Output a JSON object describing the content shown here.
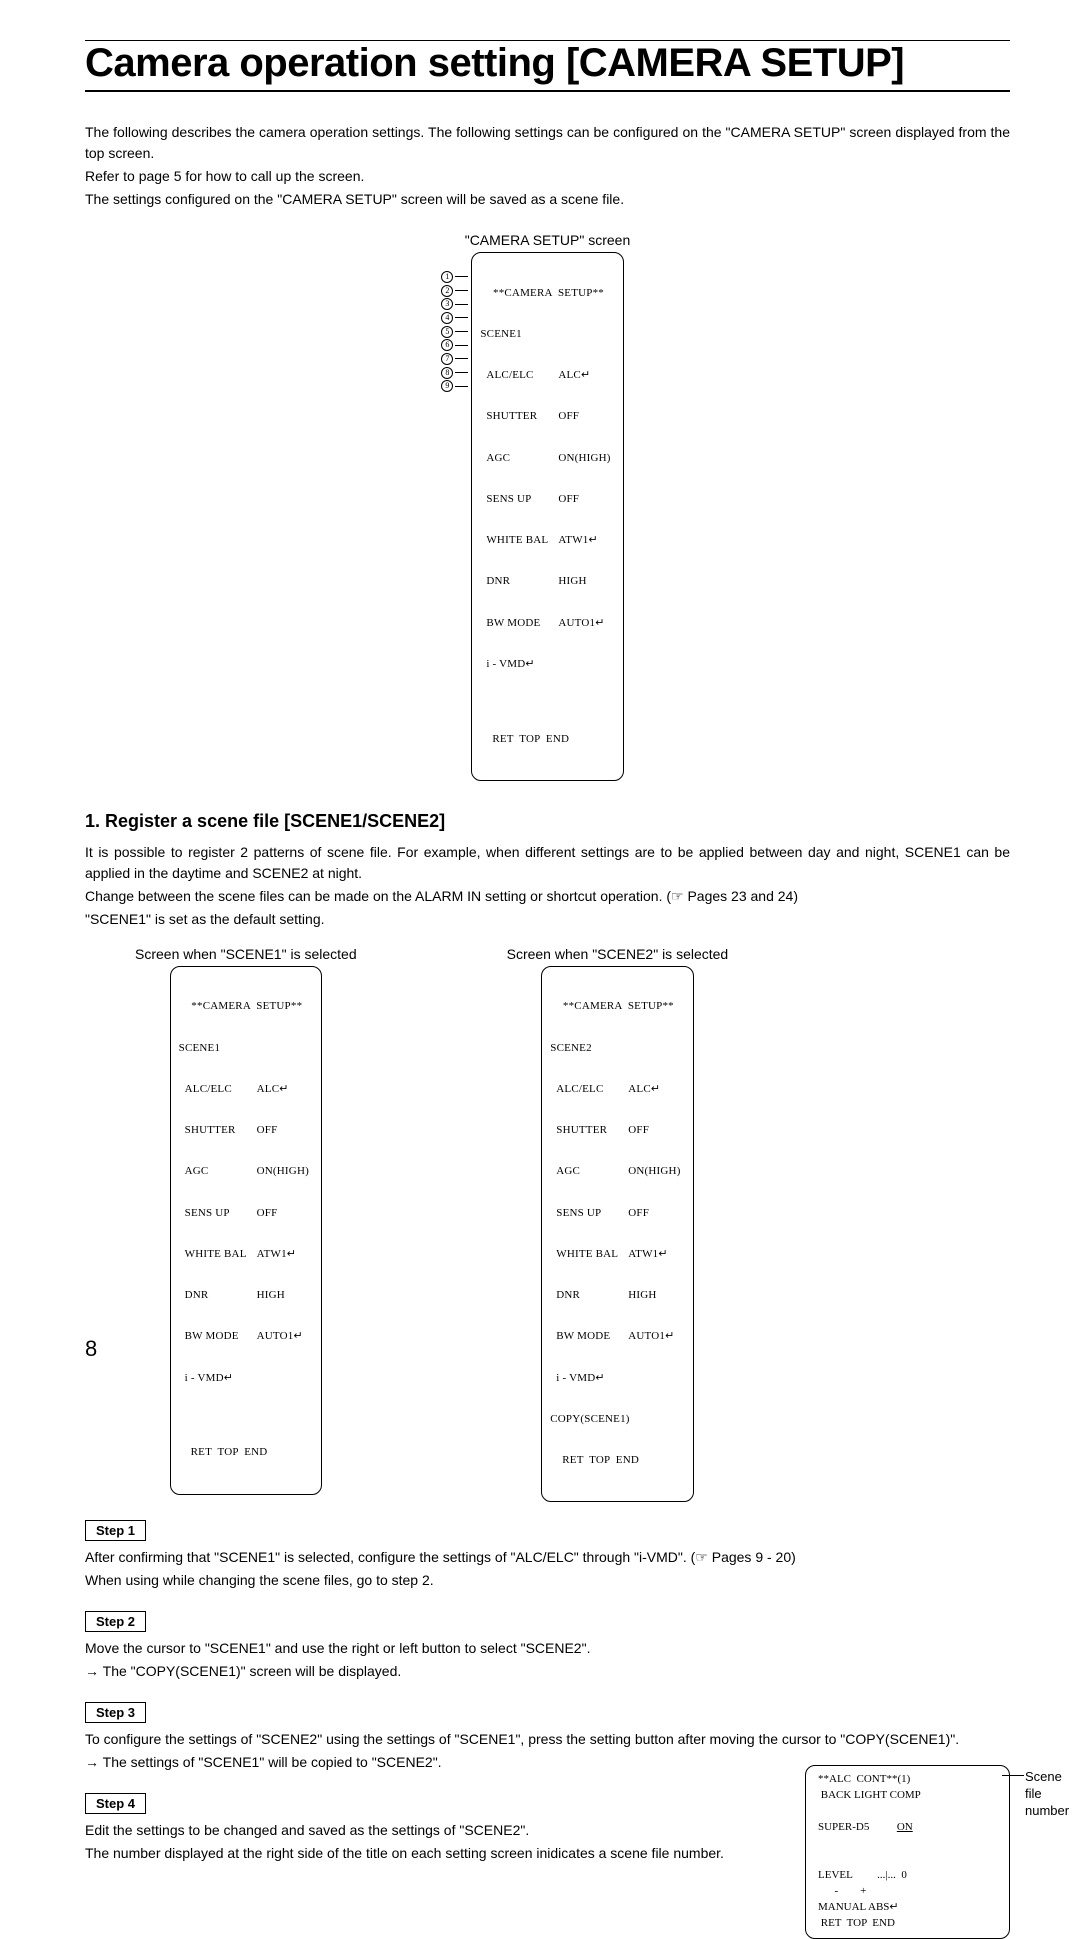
{
  "title": "Camera operation setting [CAMERA SETUP]",
  "intro": {
    "p1": "The following describes the camera operation settings. The following settings can be configured on the \"CAMERA SETUP\" screen displayed from the top screen.",
    "p2": "Refer to page 5 for how to call up the screen.",
    "p3": "The settings configured on the \"CAMERA SETUP\" screen will be saved as a scene file."
  },
  "diagram_main": {
    "caption": "\"CAMERA SETUP\" screen",
    "title": "**CAMERA  SETUP**",
    "rows": [
      {
        "n": "1",
        "label": "SCENE1",
        "val": ""
      },
      {
        "n": "2",
        "label": "ALC/ELC",
        "val": "ALC↵"
      },
      {
        "n": "3",
        "label": "SHUTTER",
        "val": "OFF"
      },
      {
        "n": "4",
        "label": "AGC",
        "val": "ON(HIGH)"
      },
      {
        "n": "5",
        "label": "SENS UP",
        "val": "OFF"
      },
      {
        "n": "6",
        "label": "WHITE BAL",
        "val": "ATW1↵"
      },
      {
        "n": "7",
        "label": "DNR",
        "val": "HIGH"
      },
      {
        "n": "8",
        "label": "BW MODE",
        "val": "AUTO1↵"
      },
      {
        "n": "9",
        "label": "i - VMD↵",
        "val": ""
      }
    ],
    "footer": "RET  TOP  END"
  },
  "section1": {
    "heading": "1. Register a scene file [SCENE1/SCENE2]",
    "p1": "It is possible to register 2 patterns of scene file. For example, when different settings are to be applied between day and night, SCENE1 can be applied in the daytime and SCENE2 at night.",
    "p2": "Change between the scene files can be made on the ALARM IN setting or shortcut operation. (☞ Pages 23 and 24)",
    "p3": "\"SCENE1\" is set as the default setting."
  },
  "diagram_scene1": {
    "caption": "Screen when \"SCENE1\" is selected",
    "title": "**CAMERA  SETUP**",
    "rows": [
      {
        "label": "SCENE1",
        "val": ""
      },
      {
        "label": "ALC/ELC",
        "val": "ALC↵"
      },
      {
        "label": "SHUTTER",
        "val": "OFF"
      },
      {
        "label": "AGC",
        "val": "ON(HIGH)"
      },
      {
        "label": "SENS UP",
        "val": "OFF"
      },
      {
        "label": "WHITE BAL",
        "val": "ATW1↵"
      },
      {
        "label": "DNR",
        "val": "HIGH"
      },
      {
        "label": "BW MODE",
        "val": "AUTO1↵"
      },
      {
        "label": "i - VMD↵",
        "val": ""
      }
    ],
    "footer": "RET  TOP  END"
  },
  "diagram_scene2": {
    "caption": "Screen when \"SCENE2\" is selected",
    "title": "**CAMERA  SETUP**",
    "rows": [
      {
        "label": "SCENE2",
        "val": ""
      },
      {
        "label": "ALC/ELC",
        "val": "ALC↵"
      },
      {
        "label": "SHUTTER",
        "val": "OFF"
      },
      {
        "label": "AGC",
        "val": "ON(HIGH)"
      },
      {
        "label": "SENS UP",
        "val": "OFF"
      },
      {
        "label": "WHITE BAL",
        "val": "ATW1↵"
      },
      {
        "label": "DNR",
        "val": "HIGH"
      },
      {
        "label": "BW MODE",
        "val": "AUTO1↵"
      },
      {
        "label": "i - VMD↵",
        "val": ""
      },
      {
        "label": "COPY(SCENE1)",
        "val": ""
      }
    ],
    "footer": "RET  TOP  END"
  },
  "steps": {
    "step1_label": "Step 1",
    "step1_p1": "After confirming that \"SCENE1\" is selected, configure the settings of \"ALC/ELC\" through \"i-VMD\". (☞ Pages 9 - 20)",
    "step1_p2": "When using while changing the scene files, go to step 2.",
    "step2_label": "Step 2",
    "step2_p1": "Move the cursor to \"SCENE1\" and use the right or left button to select \"SCENE2\".",
    "step2_p2": "→ The \"COPY(SCENE1)\" screen will be displayed.",
    "step3_label": "Step 3",
    "step3_p1": "To configure the settings of \"SCENE2\" using the settings of \"SCENE1\", press the setting button after moving the cursor to \"COPY(SCENE1)\".",
    "step3_p2": "→ The settings of \"SCENE1\" will be copied to \"SCENE2\".",
    "step4_label": "Step 4",
    "step4_p1": "Edit the settings to be changed and saved as the settings of \"SCENE2\".",
    "step4_p2": "The number displayed at the right side of the title on each setting screen inidicates a scene file number."
  },
  "alc_box": {
    "title": "**ALC  CONT**(1)",
    "line1": " BACK LIGHT COMP",
    "line2_label": "SUPER-D5",
    "line2_val": "ON",
    "level_label": "LEVEL",
    "level_val": "...|...  0",
    "level_scale": "      -        +",
    "manual": "MANUAL ABS↵",
    "footer": " RET  TOP  END",
    "annot": "Scene file number"
  },
  "page_number": "8"
}
